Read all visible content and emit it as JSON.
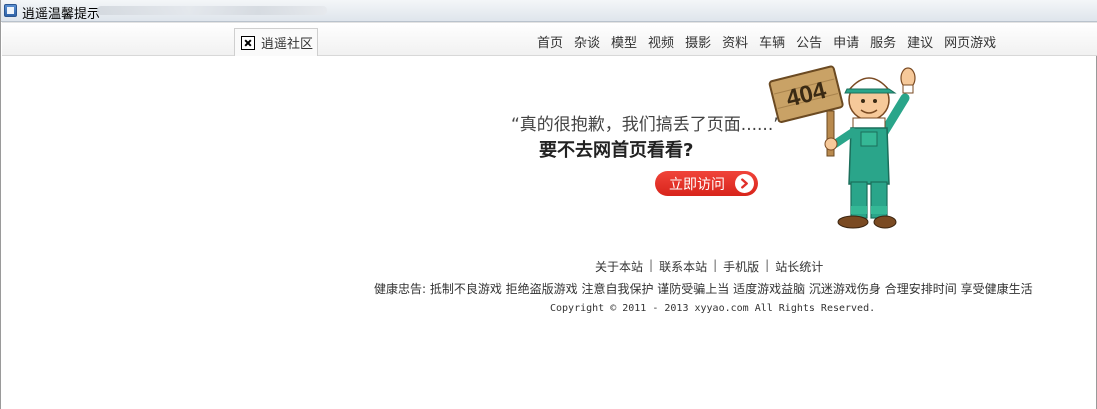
{
  "window": {
    "title": "逍遥温馨提示"
  },
  "nav": {
    "brand": "逍遥社区",
    "items": [
      "首页",
      "杂谈",
      "模型",
      "视频",
      "摄影",
      "资料",
      "车辆",
      "公告",
      "申请",
      "服务",
      "建议",
      "网页游戏"
    ]
  },
  "error": {
    "sign_text": "404",
    "line1": "“真的很抱歉，我们搞丢了页面......”",
    "line2": "要不去网首页看看?",
    "button_label": "立即访问"
  },
  "footer": {
    "links": [
      "关于本站",
      "联系本站",
      "手机版",
      "站长统计"
    ],
    "separator": "|",
    "health_notice": "健康忠告: 抵制不良游戏  拒绝盗版游戏  注意自我保护  谨防受骗上当  适度游戏益脑  沉迷游戏伤身  合理安排时间  享受健康生活",
    "copyright": "Copyright © 2011 - 2013 xyyao.com All Rights Reserved."
  },
  "colors": {
    "button": "#e0302a",
    "mascot_overalls": "#2aa58a",
    "sign_wood": "#c9a266"
  }
}
